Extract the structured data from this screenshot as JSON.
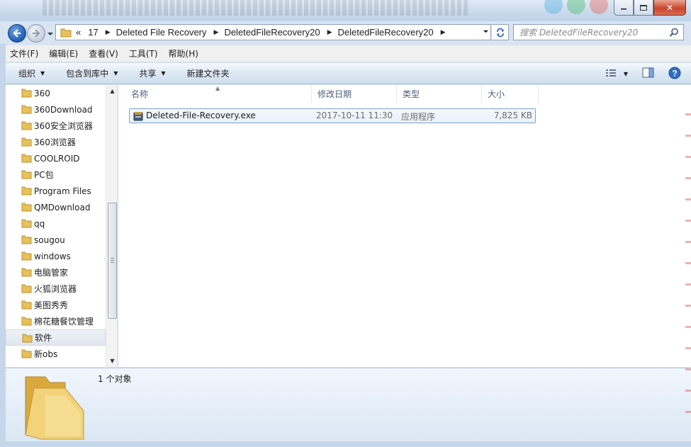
{
  "window": {
    "minimize_glyph": "▁",
    "maximize_glyph": "▫",
    "close_glyph": "✕"
  },
  "address": {
    "overflow": "«",
    "crumbs": [
      "17",
      "Deleted File Recovery",
      "DeletedFileRecovery20",
      "DeletedFileRecovery20"
    ],
    "separator": "▶"
  },
  "search": {
    "placeholder": "搜索 DeletedFileRecovery20"
  },
  "menu": [
    "文件(F)",
    "编辑(E)",
    "查看(V)",
    "工具(T)",
    "帮助(H)"
  ],
  "commands": [
    "组织",
    "包含到库中",
    "共享",
    "新建文件夹"
  ],
  "nav": {
    "items": [
      "360",
      "360Download",
      "360安全浏览器",
      "360浏览器",
      "COOLROID",
      "PC包",
      "Program Files",
      "QMDownload",
      "qq",
      "sougou",
      "windows",
      "电脑管家",
      "火狐浏览器",
      "美图秀秀",
      "棉花糖餐饮管理",
      "软件",
      "新obs"
    ],
    "selected_index": 15
  },
  "columns": [
    "名称",
    "修改日期",
    "类型",
    "大小"
  ],
  "files": [
    {
      "name": "Deleted-File-Recovery.exe",
      "modified": "2017-10-11 11:30",
      "type": "应用程序",
      "size": "7,825 KB"
    }
  ],
  "details": {
    "count_text": "1 个对象"
  },
  "colors": {
    "selection_border": "#7da2ce",
    "folder": "#e8c15c",
    "chrome": "#d8e4f2"
  }
}
